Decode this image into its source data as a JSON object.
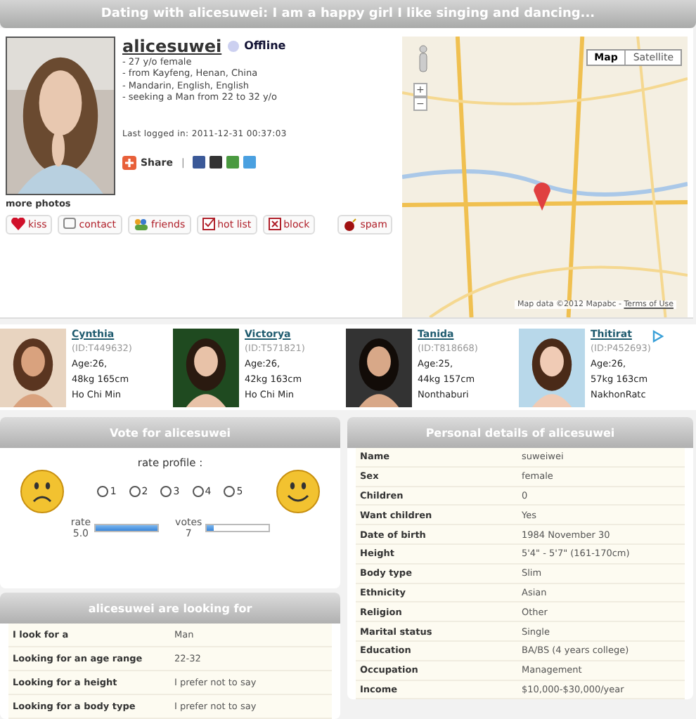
{
  "header": {
    "title": "Dating with alicesuwei: I am a happy girl I like singing and dancing..."
  },
  "profile": {
    "username": "alicesuwei",
    "status": "Offline",
    "online": false,
    "facts": [
      "- 27 y/o female",
      "- from Kayfeng, Henan, China",
      "- Mandarin, English, English",
      "- seeking a Man from 22 to 32 y/o"
    ],
    "last_logged_label": "Last logged in:",
    "last_logged": "2011-12-31 00:37:03",
    "share_label": "Share",
    "share_separator": "|",
    "more_photos": "more photos",
    "actions": [
      {
        "kind": "kiss",
        "label": "kiss"
      },
      {
        "kind": "contact",
        "label": "contact"
      },
      {
        "kind": "friends",
        "label": "friends"
      },
      {
        "kind": "hotlist",
        "label": "hot list"
      },
      {
        "kind": "block",
        "label": "block"
      },
      {
        "kind": "spam",
        "label": "spam"
      }
    ]
  },
  "map": {
    "modes": [
      {
        "label": "Map",
        "selected": true
      },
      {
        "label": "Satellite",
        "selected": false
      }
    ],
    "zoom_in": "+",
    "zoom_out": "−",
    "attribution": "Map data ©2012 Mapabc - ",
    "terms": "Terms of Use"
  },
  "suggestions": [
    {
      "name": "Cynthia",
      "id": "(ID:T449632)",
      "age": "Age:26,",
      "size": "48kg 165cm",
      "city": "Ho Chi Min"
    },
    {
      "name": "Victorya",
      "id": "(ID:T571821)",
      "age": "Age:26,",
      "size": "42kg 163cm",
      "city": "Ho Chi Min"
    },
    {
      "name": "Tanida",
      "id": "(ID:T818668)",
      "age": "Age:25,",
      "size": "44kg 157cm",
      "city": "Nonthaburi"
    },
    {
      "name": "Thitirat",
      "id": "(ID:P452693)",
      "age": "Age:26,",
      "size": "57kg 163cm",
      "city": "NakhonRatc"
    }
  ],
  "vote": {
    "title": "Vote for alicesuwei",
    "prompt": "rate profile :",
    "options": [
      {
        "label": "1",
        "selected": false
      },
      {
        "label": "2",
        "selected": false
      },
      {
        "label": "3",
        "selected": false
      },
      {
        "label": "4",
        "selected": false
      },
      {
        "label": "5",
        "selected": false
      }
    ],
    "rate": {
      "label": "rate",
      "value": "5.0",
      "level": 1.0
    },
    "votes": {
      "label": "votes",
      "value": "7",
      "level": 0.12
    }
  },
  "looking_for": {
    "title": "alicesuwei are looking for",
    "rows": [
      {
        "label": "I look for a",
        "value": "Man"
      },
      {
        "label": "Looking for an age range",
        "value": "22-32"
      },
      {
        "label": "Looking for a height",
        "value": "I prefer not to say"
      },
      {
        "label": "Looking for a body type",
        "value": "I prefer not to say"
      }
    ]
  },
  "details": {
    "title": "Personal details of alicesuwei",
    "rows": [
      {
        "label": "Name",
        "value": "suweiwei"
      },
      {
        "label": "Sex",
        "value": "female"
      },
      {
        "label": "Children",
        "value": "0"
      },
      {
        "label": "Want children",
        "value": "Yes"
      },
      {
        "label": "Date of birth",
        "value": "1984 November 30"
      },
      {
        "label": "Height",
        "value": "5'4\" - 5'7\" (161-170cm)"
      },
      {
        "label": "Body type",
        "value": "Slim"
      },
      {
        "label": "Ethnicity",
        "value": "Asian"
      },
      {
        "label": "Religion",
        "value": "Other"
      },
      {
        "label": "Marital status",
        "value": "Single"
      },
      {
        "label": "Education",
        "value": "BA/BS (4 years college)"
      },
      {
        "label": "Occupation",
        "value": "Management"
      },
      {
        "label": "Income",
        "value": "$10,000-$30,000/year"
      }
    ]
  }
}
